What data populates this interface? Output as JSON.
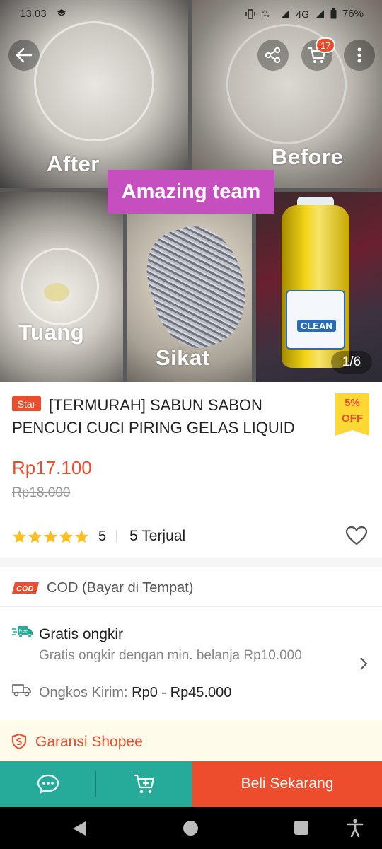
{
  "status_bar": {
    "time": "13.03",
    "network": "4G",
    "battery": "76%"
  },
  "header": {
    "cart_count": "17"
  },
  "gallery": {
    "texts": {
      "after": "After",
      "before": "Before",
      "amazing": "Amazing team",
      "tuang": "Tuang",
      "sikat": "Sikat",
      "bottle_brand": "CLEAN"
    },
    "counter": "1/6"
  },
  "product": {
    "badge": "Star",
    "title": "[TERMURAH] SABUN SABON PENCUCI CUCI PIRING GELAS LIQUID",
    "discount_pct": "5%",
    "discount_word": "OFF",
    "price": "Rp17.100",
    "original_price": "Rp18.000",
    "rating": "5",
    "stars": 5,
    "sold": "5 Terjual"
  },
  "cod": {
    "badge": "COD",
    "label": "COD (Bayar di Tempat)"
  },
  "shipping": {
    "free_badge": "Free",
    "free_title": "Gratis ongkir",
    "free_subtitle": "Gratis ongkir dengan min. belanja Rp10.000",
    "cost_label": "Ongkos Kirim:",
    "cost_value": "Rp0 - Rp45.000"
  },
  "guarantee": {
    "label": "Garansi Shopee"
  },
  "action_bar": {
    "buy_label": "Beli Sekarang"
  },
  "colors": {
    "brand": "#ee4d2d",
    "teal": "#26aa99",
    "star": "#fbbf24",
    "discount_bg": "#fdd835"
  },
  "icons": [
    "back-arrow-icon",
    "share-icon",
    "cart-icon",
    "more-vertical-icon",
    "star-icon",
    "heart-icon",
    "cod-icon",
    "free-shipping-icon",
    "truck-icon",
    "chevron-right-icon",
    "shield-icon",
    "chat-icon",
    "add-to-cart-icon",
    "nav-back-icon",
    "nav-home-icon",
    "nav-recents-icon",
    "accessibility-icon"
  ]
}
